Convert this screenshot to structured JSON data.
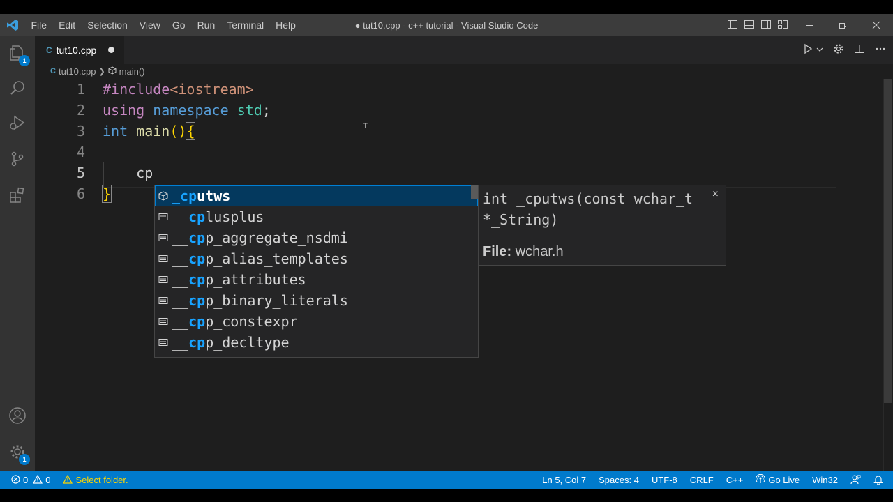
{
  "titlebar": {
    "menu": [
      "File",
      "Edit",
      "Selection",
      "View",
      "Go",
      "Run",
      "Terminal",
      "Help"
    ],
    "title": "● tut10.cpp - c++ tutorial - Visual Studio Code"
  },
  "activity": {
    "explorer_badge": "1",
    "settings_badge": "1"
  },
  "tab": {
    "label": "tut10.cpp",
    "icon_text": "C"
  },
  "breadcrumb": {
    "file": "tut10.cpp",
    "symbol": "main()"
  },
  "editor": {
    "line_numbers": [
      "1",
      "2",
      "3",
      "4",
      "5",
      "6"
    ],
    "lines": [
      {
        "pre": "#include",
        "str": "<iostream>"
      },
      {
        "kw1": "using",
        "kw2": "namespace",
        "ns": "std",
        "semi": ";"
      },
      {
        "kw": "int",
        "fn": "main",
        "parens": "()",
        "brace": "{"
      },
      {},
      {
        "typed": "    cp"
      },
      {
        "brace": "}"
      }
    ]
  },
  "suggest": {
    "items": [
      {
        "match": "_cp",
        "rest": "utws",
        "icon": "cube-icon"
      },
      {
        "pre": "__",
        "match": "cp",
        "rest": "lusplus",
        "icon": "text-icon"
      },
      {
        "pre": "__",
        "match": "cp",
        "rest": "p_aggregate_nsdmi",
        "icon": "text-icon"
      },
      {
        "pre": "__",
        "match": "cp",
        "rest": "p_alias_templates",
        "icon": "text-icon"
      },
      {
        "pre": "__",
        "match": "cp",
        "rest": "p_attributes",
        "icon": "text-icon"
      },
      {
        "pre": "__",
        "match": "cp",
        "rest": "p_binary_literals",
        "icon": "text-icon"
      },
      {
        "pre": "__",
        "match": "cp",
        "rest": "p_constexpr",
        "icon": "text-icon"
      },
      {
        "pre": "__",
        "match": "cp",
        "rest": "p_decltype",
        "icon": "text-icon"
      }
    ]
  },
  "detail": {
    "signature": "int _cputws(const wchar_t *_String)",
    "file_label": "File:",
    "file_value": "wchar.h",
    "close": "×"
  },
  "statusbar": {
    "errors": "0",
    "warnings": "0",
    "select_folder": "Select folder.",
    "position": "Ln 5, Col 7",
    "spaces": "Spaces: 4",
    "encoding": "UTF-8",
    "eol": "CRLF",
    "language": "C++",
    "go_live": "Go Live",
    "platform": "Win32"
  },
  "colors": {
    "accent": "#007acc",
    "match": "#18a3ff",
    "keyword": "#569cd6",
    "preprocessor": "#c586c0",
    "string": "#ce9178"
  }
}
